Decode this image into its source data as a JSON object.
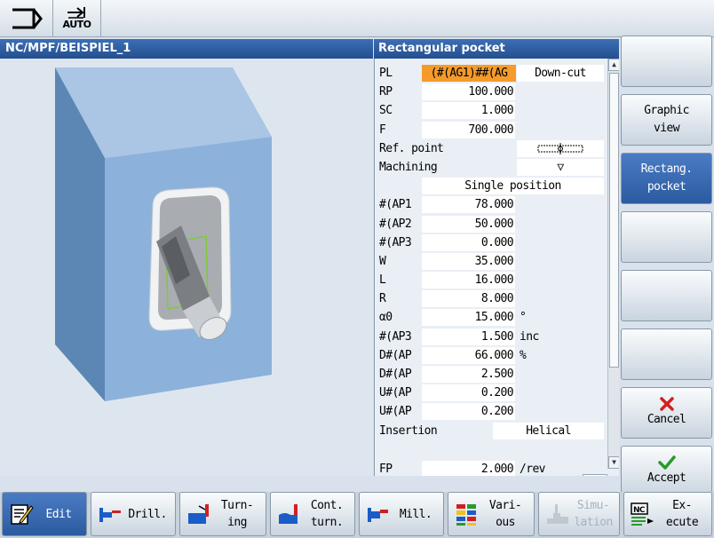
{
  "topbar": {
    "machine_icon": "machine-area-icon",
    "auto_icon": "auto-mode-icon",
    "auto_label": "AUTO"
  },
  "graphic": {
    "path": "NC/MPF/BEISPIEL_1"
  },
  "panel": {
    "title": "Rectangular pocket",
    "pl": {
      "label": "PL",
      "value": "(#(AG1)##(AG",
      "mode": "Down-cut"
    },
    "rp": {
      "label": "RP",
      "value": "100.000"
    },
    "sc": {
      "label": "SC",
      "value": "1.000"
    },
    "f": {
      "label": "F",
      "value": "700.000"
    },
    "ref_point": {
      "label": "Ref. point"
    },
    "machining": {
      "label": "Machining",
      "symbol": "▽"
    },
    "position_mode": "Single position",
    "params": [
      {
        "label": "#(AP1",
        "value": "78.000",
        "unit": ""
      },
      {
        "label": "#(AP2",
        "value": "50.000",
        "unit": ""
      },
      {
        "label": "#(AP3",
        "value": "0.000",
        "unit": ""
      },
      {
        "label": "W",
        "value": "35.000",
        "unit": ""
      },
      {
        "label": "L",
        "value": "16.000",
        "unit": ""
      },
      {
        "label": "R",
        "value": "8.000",
        "unit": ""
      },
      {
        "label": "α0",
        "value": "15.000",
        "unit": "°"
      },
      {
        "label": "#(AP3",
        "value": "1.500",
        "unit": "inc"
      },
      {
        "label": "D#(AP",
        "value": "66.000",
        "unit": "%"
      },
      {
        "label": "D#(AP",
        "value": "2.500",
        "unit": ""
      },
      {
        "label": "U#(AP",
        "value": "0.200",
        "unit": ""
      },
      {
        "label": "U#(AP",
        "value": "0.200",
        "unit": ""
      }
    ],
    "insertion": {
      "label": "Insertion",
      "value": "Helical"
    },
    "fp": {
      "label": "FP",
      "value": "2.000",
      "unit": "/rev"
    },
    "hscroll_label": ">"
  },
  "vertical_softkeys": [
    {
      "line1": "",
      "line2": ""
    },
    {
      "line1": "Graphic",
      "line2": "view"
    },
    {
      "line1": "Rectang.",
      "line2": "pocket"
    },
    {
      "line1": "",
      "line2": ""
    },
    {
      "line1": "",
      "line2": ""
    },
    {
      "line1": "",
      "line2": ""
    },
    {
      "line1": "Cancel",
      "icon": "cancel-x-icon"
    },
    {
      "line1": "Accept",
      "icon": "accept-check-icon"
    }
  ],
  "horizontal_softkeys": [
    {
      "line1": "Edit",
      "line2": "",
      "icon": "edit-icon"
    },
    {
      "line1": "Drill.",
      "line2": "",
      "icon": "drill-icon"
    },
    {
      "line1": "Turn-",
      "line2": "ing",
      "icon": "turning-icon"
    },
    {
      "line1": "Cont.",
      "line2": "turn.",
      "icon": "contour-turning-icon"
    },
    {
      "line1": "Mill.",
      "line2": "",
      "icon": "milling-icon"
    },
    {
      "line1": "Vari-",
      "line2": "ous",
      "icon": "various-icon"
    },
    {
      "line1": "Simu-",
      "line2": "lation",
      "icon": "simulation-icon"
    },
    {
      "line1": "Ex-",
      "line2": "ecute",
      "icon": "nc-execute-icon",
      "icon_text": "NC"
    }
  ],
  "colors": {
    "title_bar": "#2f5f9f",
    "active_softkey": "#3a6ab4",
    "pl_highlight": "#f49b2c",
    "block_face": "#7fa8d4",
    "cancel_red": "#d22020",
    "accept_green": "#2a9a2a"
  }
}
